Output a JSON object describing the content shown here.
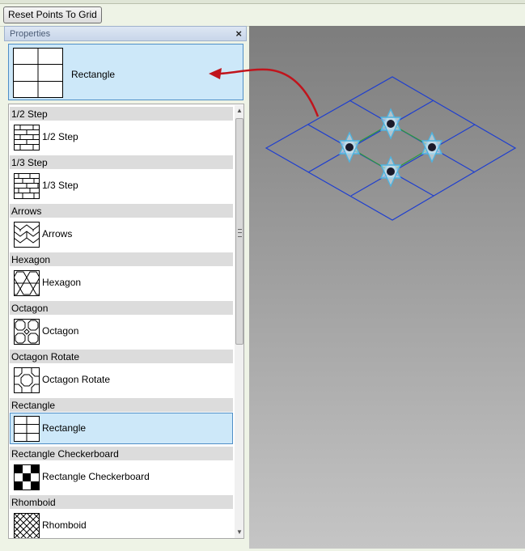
{
  "toolbar": {
    "reset_button": "Reset Points To Grid"
  },
  "panel": {
    "title": "Properties",
    "selected": {
      "label": "Rectangle",
      "icon": "rectangle-pattern-icon"
    }
  },
  "groups": [
    {
      "header": "1/2 Step",
      "item": "1/2 Step",
      "icon": "half-step-pattern-icon"
    },
    {
      "header": "1/3 Step",
      "item": "1/3 Step",
      "icon": "third-step-pattern-icon"
    },
    {
      "header": "Arrows",
      "item": "Arrows",
      "icon": "arrows-pattern-icon"
    },
    {
      "header": "Hexagon",
      "item": "Hexagon",
      "icon": "hexagon-pattern-icon"
    },
    {
      "header": "Octagon",
      "item": "Octagon",
      "icon": "octagon-pattern-icon"
    },
    {
      "header": "Octagon Rotate",
      "item": "Octagon Rotate",
      "icon": "octagon-rotate-pattern-icon"
    },
    {
      "header": "Rectangle",
      "item": "Rectangle",
      "icon": "rectangle-pattern-icon",
      "selected": true
    },
    {
      "header": "Rectangle Checkerboard",
      "item": "Rectangle Checkerboard",
      "icon": "checkerboard-pattern-icon"
    },
    {
      "header": "Rhomboid",
      "item": "Rhomboid",
      "icon": "rhomboid-pattern-icon"
    }
  ],
  "colors": {
    "selection": "#cde8f9",
    "selection_border": "#4f8fc7",
    "grid_line": "#1f3fcf",
    "arrow": "#c0141c",
    "node_star": "#4eb3e0"
  }
}
